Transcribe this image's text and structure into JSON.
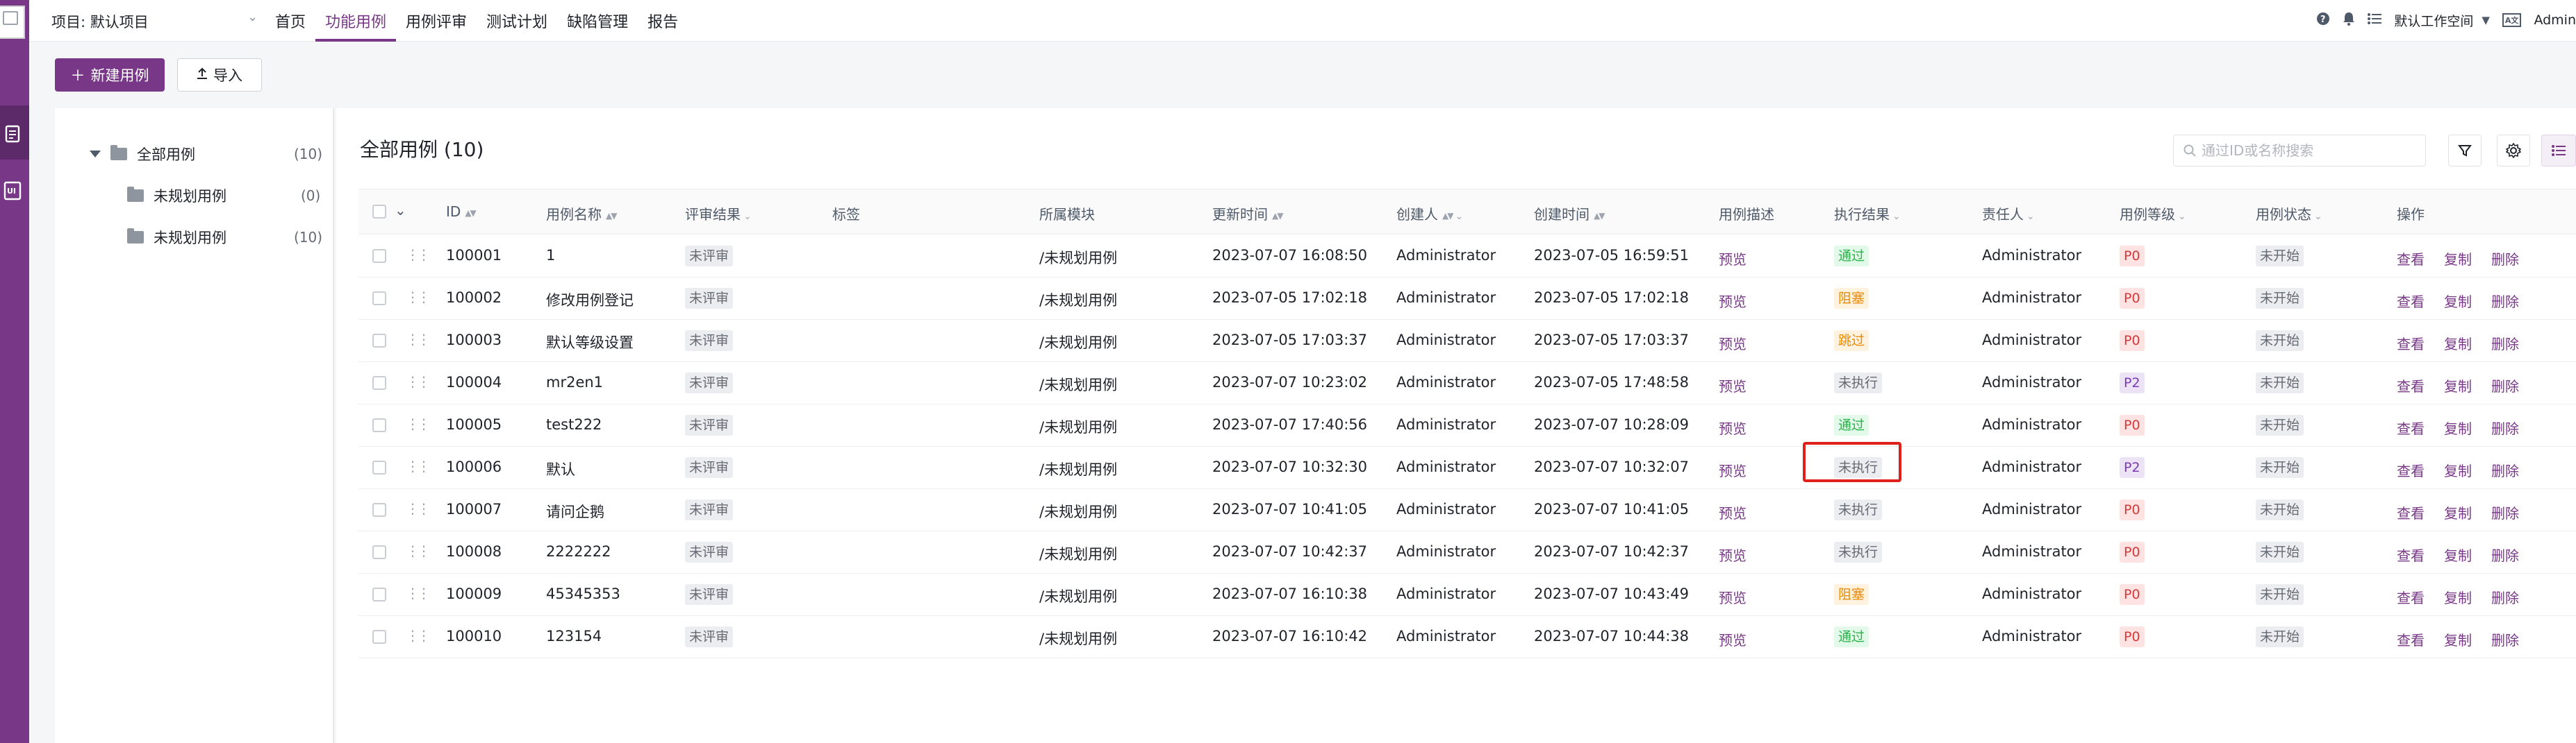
{
  "topbar": {
    "project_label": "项目: 默认项目",
    "nav": [
      "首页",
      "功能用例",
      "用例评审",
      "测试计划",
      "缺陷管理",
      "报告"
    ],
    "active_nav_index": 1,
    "workspace": "默认工作空间",
    "user": "Admin",
    "lang_badge": "A文"
  },
  "toolbar": {
    "new_case": "新建用例",
    "import": "导入"
  },
  "tree": {
    "root": {
      "label": "全部用例",
      "count": "(10)"
    },
    "children": [
      {
        "label": "未规划用例",
        "count": "(0)"
      },
      {
        "label": "未规划用例",
        "count": "(10)"
      }
    ]
  },
  "content": {
    "title": "全部用例 (10)",
    "search_placeholder": "通过ID或名称搜索"
  },
  "table": {
    "headers": [
      "ID",
      "用例名称",
      "评审结果",
      "标签",
      "所属模块",
      "更新时间",
      "创建人",
      "创建时间",
      "用例描述",
      "执行结果",
      "责任人",
      "用例等级",
      "用例状态",
      "操作"
    ],
    "rows": [
      {
        "id": "100001",
        "name": "1",
        "review": "未评审",
        "module": "/未规划用例",
        "updated": "2023-07-07 16:08:50",
        "creator": "Administrator",
        "created": "2023-07-05 16:59:51",
        "desc": "预览",
        "result": "通过",
        "result_color": "green",
        "owner": "Administrator",
        "level": "P0",
        "status": "未开始"
      },
      {
        "id": "100002",
        "name": "修改用例登记",
        "review": "未评审",
        "module": "/未规划用例",
        "updated": "2023-07-05 17:02:18",
        "creator": "Administrator",
        "created": "2023-07-05 17:02:18",
        "desc": "预览",
        "result": "阻塞",
        "result_color": "orange",
        "owner": "Administrator",
        "level": "P0",
        "status": "未开始"
      },
      {
        "id": "100003",
        "name": "默认等级设置",
        "review": "未评审",
        "module": "/未规划用例",
        "updated": "2023-07-05 17:03:37",
        "creator": "Administrator",
        "created": "2023-07-05 17:03:37",
        "desc": "预览",
        "result": "跳过",
        "result_color": "orange",
        "owner": "Administrator",
        "level": "P0",
        "status": "未开始"
      },
      {
        "id": "100004",
        "name": "mr2en1",
        "review": "未评审",
        "module": "/未规划用例",
        "updated": "2023-07-07 10:23:02",
        "creator": "Administrator",
        "created": "2023-07-05 17:48:58",
        "desc": "预览",
        "result": "未执行",
        "result_color": "gray",
        "owner": "Administrator",
        "level": "P2",
        "status": "未开始"
      },
      {
        "id": "100005",
        "name": "test222",
        "review": "未评审",
        "module": "/未规划用例",
        "updated": "2023-07-07 17:40:56",
        "creator": "Administrator",
        "created": "2023-07-07 10:28:09",
        "desc": "预览",
        "result": "通过",
        "result_color": "green",
        "owner": "Administrator",
        "level": "P0",
        "status": "未开始"
      },
      {
        "id": "100006",
        "name": "默认",
        "review": "未评审",
        "module": "/未规划用例",
        "updated": "2023-07-07 10:32:30",
        "creator": "Administrator",
        "created": "2023-07-07 10:32:07",
        "desc": "预览",
        "result": "未执行",
        "result_color": "gray",
        "owner": "Administrator",
        "level": "P2",
        "status": "未开始"
      },
      {
        "id": "100007",
        "name": "请问企鹅",
        "review": "未评审",
        "module": "/未规划用例",
        "updated": "2023-07-07 10:41:05",
        "creator": "Administrator",
        "created": "2023-07-07 10:41:05",
        "desc": "预览",
        "result": "未执行",
        "result_color": "gray",
        "owner": "Administrator",
        "level": "P0",
        "status": "未开始"
      },
      {
        "id": "100008",
        "name": "2222222",
        "review": "未评审",
        "module": "/未规划用例",
        "updated": "2023-07-07 10:42:37",
        "creator": "Administrator",
        "created": "2023-07-07 10:42:37",
        "desc": "预览",
        "result": "未执行",
        "result_color": "gray",
        "owner": "Administrator",
        "level": "P0",
        "status": "未开始"
      },
      {
        "id": "100009",
        "name": "45345353",
        "review": "未评审",
        "module": "/未规划用例",
        "updated": "2023-07-07 16:10:38",
        "creator": "Administrator",
        "created": "2023-07-07 10:43:49",
        "desc": "预览",
        "result": "阻塞",
        "result_color": "orange",
        "owner": "Administrator",
        "level": "P0",
        "status": "未开始"
      },
      {
        "id": "100010",
        "name": "123154",
        "review": "未评审",
        "module": "/未规划用例",
        "updated": "2023-07-07 16:10:42",
        "creator": "Administrator",
        "created": "2023-07-07 10:44:38",
        "desc": "预览",
        "result": "通过",
        "result_color": "green",
        "owner": "Administrator",
        "level": "P0",
        "status": "未开始"
      }
    ],
    "ops": [
      "查看",
      "复制",
      "删除"
    ]
  },
  "icons": {
    "help": "help-icon",
    "bell": "bell-icon",
    "workspace": "list-icon",
    "filter": "filter-icon",
    "settings": "gear-icon",
    "list_view": "list-view-icon"
  },
  "colors": {
    "brand": "#783887",
    "highlight": "#e0201b"
  }
}
